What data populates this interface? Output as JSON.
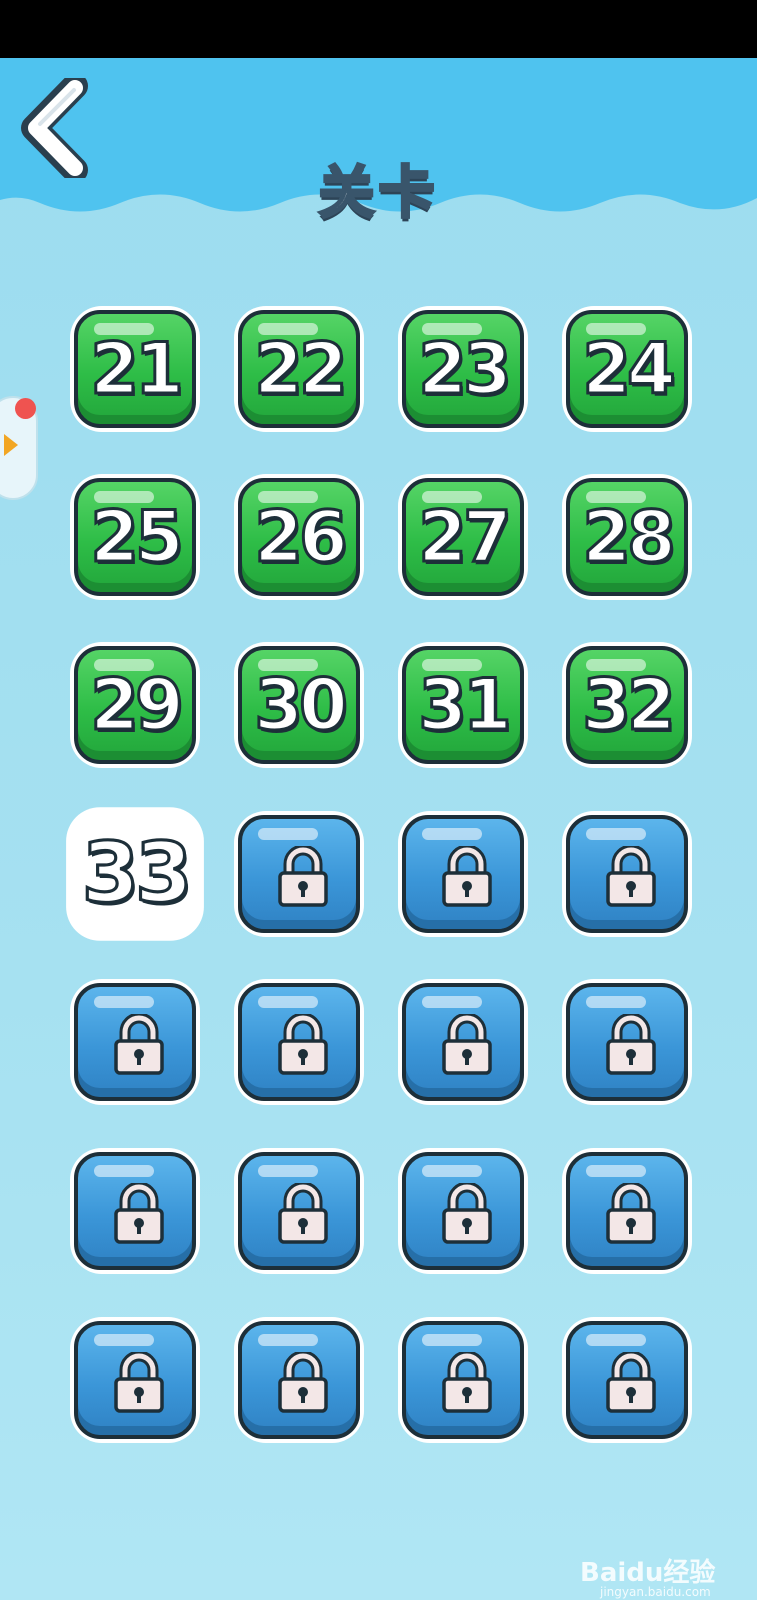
{
  "header": {
    "title": "关卡",
    "back_label": "back"
  },
  "colors": {
    "sky": "#4fc3ef",
    "unlocked": "#2ebd47",
    "current": "#e8b728",
    "locked": "#3b96d8"
  },
  "levels": [
    {
      "label": "21",
      "state": "unlocked"
    },
    {
      "label": "22",
      "state": "unlocked"
    },
    {
      "label": "23",
      "state": "unlocked"
    },
    {
      "label": "24",
      "state": "unlocked"
    },
    {
      "label": "25",
      "state": "unlocked"
    },
    {
      "label": "26",
      "state": "unlocked"
    },
    {
      "label": "27",
      "state": "unlocked"
    },
    {
      "label": "28",
      "state": "unlocked"
    },
    {
      "label": "29",
      "state": "unlocked"
    },
    {
      "label": "30",
      "state": "unlocked"
    },
    {
      "label": "31",
      "state": "unlocked"
    },
    {
      "label": "32",
      "state": "unlocked"
    },
    {
      "label": "33",
      "state": "current"
    },
    {
      "label": "",
      "state": "locked",
      "icon": "lock-icon"
    },
    {
      "label": "",
      "state": "locked",
      "icon": "lock-icon"
    },
    {
      "label": "",
      "state": "locked",
      "icon": "lock-icon"
    },
    {
      "label": "",
      "state": "locked",
      "icon": "lock-icon"
    },
    {
      "label": "",
      "state": "locked",
      "icon": "lock-icon"
    },
    {
      "label": "",
      "state": "locked",
      "icon": "lock-icon"
    },
    {
      "label": "",
      "state": "locked",
      "icon": "lock-icon"
    },
    {
      "label": "",
      "state": "locked",
      "icon": "lock-icon"
    },
    {
      "label": "",
      "state": "locked",
      "icon": "lock-icon"
    },
    {
      "label": "",
      "state": "locked",
      "icon": "lock-icon"
    },
    {
      "label": "",
      "state": "locked",
      "icon": "lock-icon"
    },
    {
      "label": "",
      "state": "locked",
      "icon": "lock-icon"
    },
    {
      "label": "",
      "state": "locked",
      "icon": "lock-icon"
    },
    {
      "label": "",
      "state": "locked",
      "icon": "lock-icon"
    },
    {
      "label": "",
      "state": "locked",
      "icon": "lock-icon"
    }
  ],
  "watermark": {
    "text": "Baidu经验",
    "url": "jingyan.baidu.com"
  }
}
